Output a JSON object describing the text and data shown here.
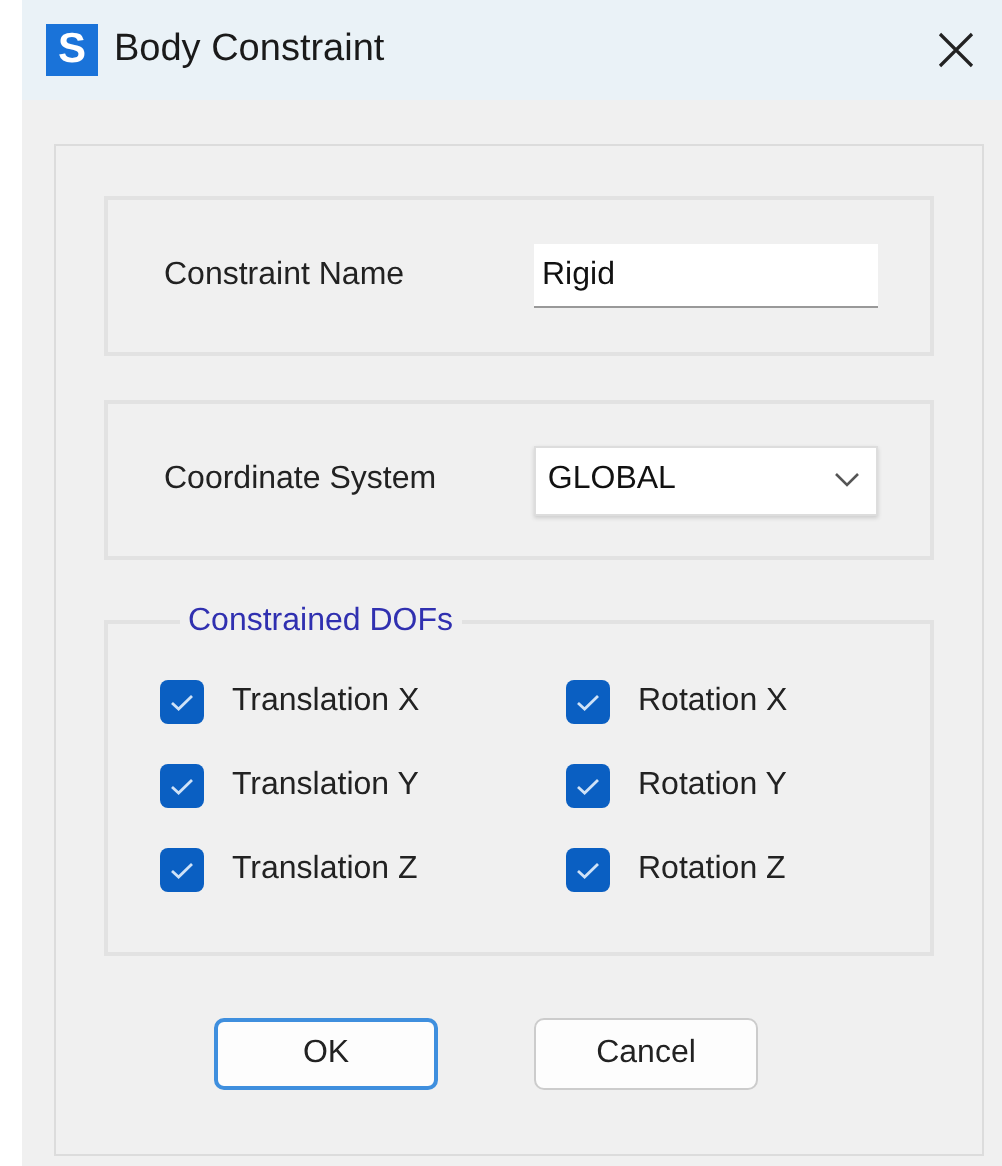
{
  "window": {
    "title": "Body Constraint",
    "app_icon_letter": "S"
  },
  "constraint_name": {
    "label": "Constraint Name",
    "value": "Rigid"
  },
  "coordinate_system": {
    "label": "Coordinate System",
    "value": "GLOBAL"
  },
  "constrained_dofs": {
    "title": "Constrained DOFs",
    "items": [
      {
        "label": "Translation X",
        "checked": true
      },
      {
        "label": "Rotation X",
        "checked": true
      },
      {
        "label": "Translation Y",
        "checked": true
      },
      {
        "label": "Rotation Y",
        "checked": true
      },
      {
        "label": "Translation Z",
        "checked": true
      },
      {
        "label": "Rotation Z",
        "checked": true
      }
    ]
  },
  "buttons": [
    {
      "label": "OK",
      "default": true
    },
    {
      "label": "Cancel",
      "default": false
    }
  ]
}
